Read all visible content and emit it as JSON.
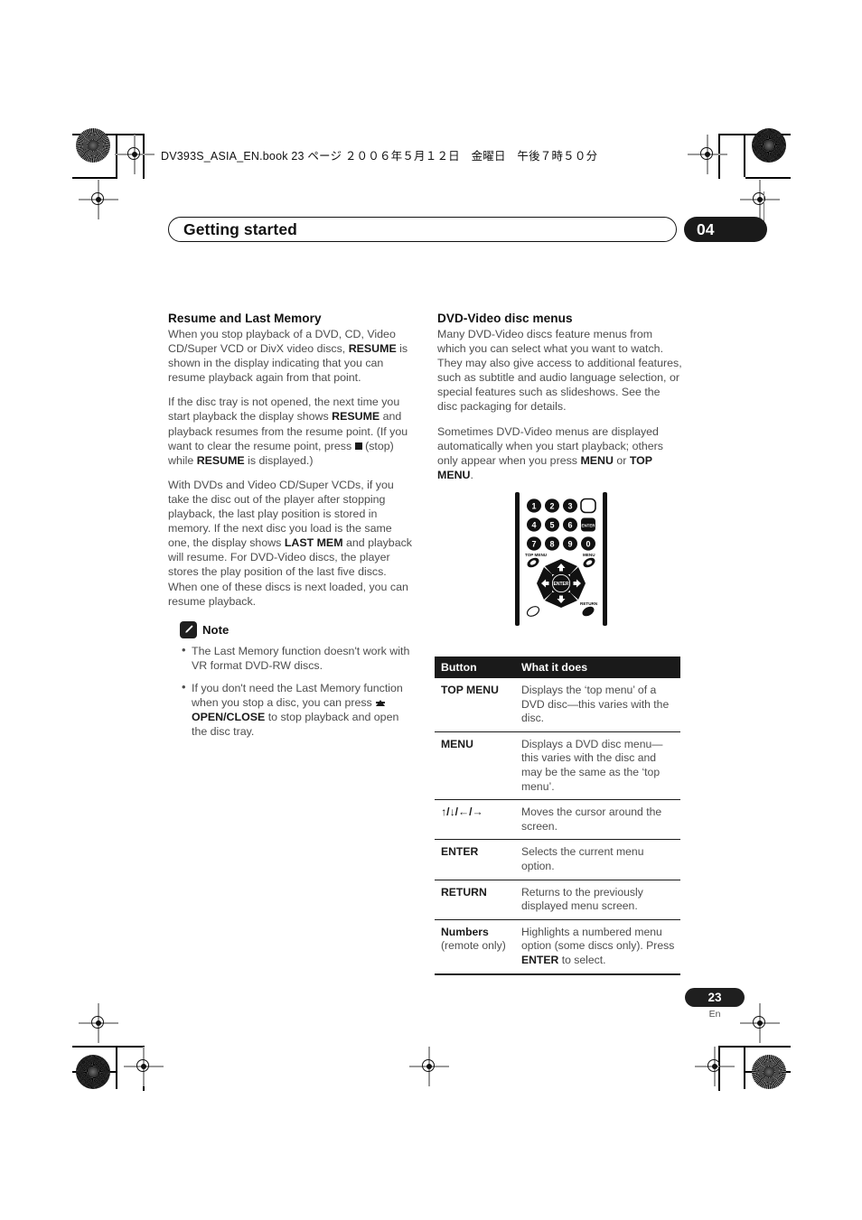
{
  "print_marks": {
    "file_header": "DV393S_ASIA_EN.book  23 ページ  ２００６年５月１２日　金曜日　午後７時５０分"
  },
  "header": {
    "title": "Getting started",
    "chapter": "04"
  },
  "left_column": {
    "heading": "Resume and Last Memory",
    "paragraphs": [
      {
        "id": "p1",
        "runs": [
          {
            "t": "When you stop playback of a DVD, CD, Video CD/Super VCD or DivX video discs, ",
            "b": false
          },
          {
            "t": "RESUME",
            "b": true
          },
          {
            "t": " is shown in the display indicating that you can resume playback again from that point.",
            "b": false
          }
        ]
      },
      {
        "id": "p2",
        "runs": [
          {
            "t": "If the disc tray is not opened, the next time you start playback the display shows ",
            "b": false
          },
          {
            "t": "RESUME",
            "b": true
          },
          {
            "t": " and playback resumes from the resume point. (If you want to clear the resume point, press ",
            "b": false
          },
          {
            "t": "[stop-square]",
            "b": false
          },
          {
            "t": " (stop) while ",
            "b": false
          },
          {
            "t": "RESUME",
            "b": true
          },
          {
            "t": " is displayed.)",
            "b": false
          }
        ]
      },
      {
        "id": "p3",
        "runs": [
          {
            "t": "With DVDs and Video CD/Super VCDs, if you take the disc out of the player after stopping playback, the last play position is stored in memory. If the next disc you load is the same one, the display shows ",
            "b": false
          },
          {
            "t": "LAST MEM",
            "b": true
          },
          {
            "t": " and playback will resume. For DVD-Video discs, the player stores the play position of the last five discs. When one of these discs is next loaded, you can resume playback.",
            "b": false
          }
        ]
      }
    ],
    "note": {
      "icon": "pencil-icon",
      "label": "Note",
      "items": [
        {
          "runs": [
            {
              "t": "The Last Memory function doesn't work with VR format DVD-RW discs.",
              "b": false
            }
          ]
        },
        {
          "runs": [
            {
              "t": "If you don't need the Last Memory function when you stop a disc, you can press ",
              "b": false
            },
            {
              "t": "[eject-triangle]",
              "b": false
            },
            {
              "t": " ",
              "b": false
            },
            {
              "t": "OPEN/CLOSE",
              "b": true
            },
            {
              "t": " to stop playback and open the disc tray.",
              "b": false
            }
          ]
        }
      ]
    }
  },
  "right_column": {
    "heading": "DVD-Video disc menus",
    "paragraphs": [
      {
        "id": "r1",
        "runs": [
          {
            "t": "Many DVD-Video discs feature menus from which you can select what you want to watch. They may also give access to additional features, such as subtitle and audio language selection, or special features such as slideshows. See the disc packaging for details.",
            "b": false
          }
        ]
      },
      {
        "id": "r2",
        "runs": [
          {
            "t": "Sometimes DVD-Video menus are displayed automatically when you start playback; others only appear when you press ",
            "b": false
          },
          {
            "t": "MENU",
            "b": true
          },
          {
            "t": " or ",
            "b": false
          },
          {
            "t": "TOP MENU",
            "b": true
          },
          {
            "t": ".",
            "b": false
          }
        ]
      }
    ],
    "remote": {
      "alt": "remote-control-illustration",
      "number_keys": [
        "1",
        "2",
        "3",
        "4",
        "5",
        "6",
        "7",
        "8",
        "9",
        "0"
      ],
      "enter_key_label": "ENTER",
      "labels": {
        "top_menu": "TOP MENU",
        "menu": "MENU",
        "return": "RETURN",
        "center": "ENTER"
      }
    },
    "table": {
      "columns": [
        "Button",
        "What it does"
      ],
      "rows": [
        {
          "button": "TOP MENU",
          "button_sub": "",
          "desc_runs": [
            {
              "t": "Displays the ‘top menu’ of a DVD disc—this varies with the disc.",
              "b": false
            }
          ]
        },
        {
          "button": "MENU",
          "button_sub": "",
          "desc_runs": [
            {
              "t": "Displays a DVD disc menu—this varies with the disc and may be the same as the ‘top menu’.",
              "b": false
            }
          ]
        },
        {
          "button": "↑/↓/←/→",
          "button_sub": "",
          "desc_runs": [
            {
              "t": "Moves the cursor around the screen.",
              "b": false
            }
          ]
        },
        {
          "button": "ENTER",
          "button_sub": "",
          "desc_runs": [
            {
              "t": "Selects the current menu option.",
              "b": false
            }
          ]
        },
        {
          "button": "RETURN",
          "button_sub": "",
          "desc_runs": [
            {
              "t": "Returns to the previously displayed menu screen.",
              "b": false
            }
          ]
        },
        {
          "button": "Numbers",
          "button_sub": "(remote only)",
          "desc_runs": [
            {
              "t": "Highlights a numbered menu option (some discs only). Press ",
              "b": false
            },
            {
              "t": "ENTER",
              "b": true
            },
            {
              "t": " to select.",
              "b": false
            }
          ]
        }
      ]
    }
  },
  "footer": {
    "page_number": "23",
    "language": "En"
  },
  "colors": {
    "ink": "#1a1a1a",
    "body_text": "#4d4d4d",
    "paper": "#ffffff"
  }
}
